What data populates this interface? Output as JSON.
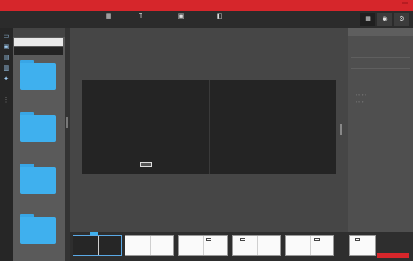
{
  "topbar": {
    "brand": "",
    "menu": [
      "",
      "",
      "",
      "",
      "",
      ""
    ],
    "signin": ""
  },
  "toolbar2": {
    "tools": [
      {
        "label": "",
        "icon": "layout-icon"
      },
      {
        "label": "",
        "icon": "text-icon"
      },
      {
        "label": "",
        "icon": "image-icon"
      },
      {
        "label": "",
        "icon": "background-icon"
      }
    ],
    "right_buttons": [
      "grid-icon",
      "eye-icon",
      "settings-icon"
    ]
  },
  "left_panel": {
    "header": "",
    "search_placeholder": "",
    "new_button": "",
    "folders": [
      {
        "name": ""
      },
      {
        "name": ""
      },
      {
        "name": ""
      },
      {
        "name": ""
      }
    ]
  },
  "canvas": {
    "left_page_label": "",
    "right_page_label": "",
    "spread_number": "",
    "left_foot": "",
    "right_foot": ""
  },
  "right_panel": {
    "header": "",
    "section1": "",
    "items": [
      "",
      "",
      ""
    ],
    "section2": ""
  },
  "zoom": {
    "controls": ""
  },
  "filmstrip": {
    "add_button": ""
  },
  "colors": {
    "accent_red": "#d6262b",
    "folder_blue": "#3fb0ee",
    "canvas_dark": "#242424"
  }
}
